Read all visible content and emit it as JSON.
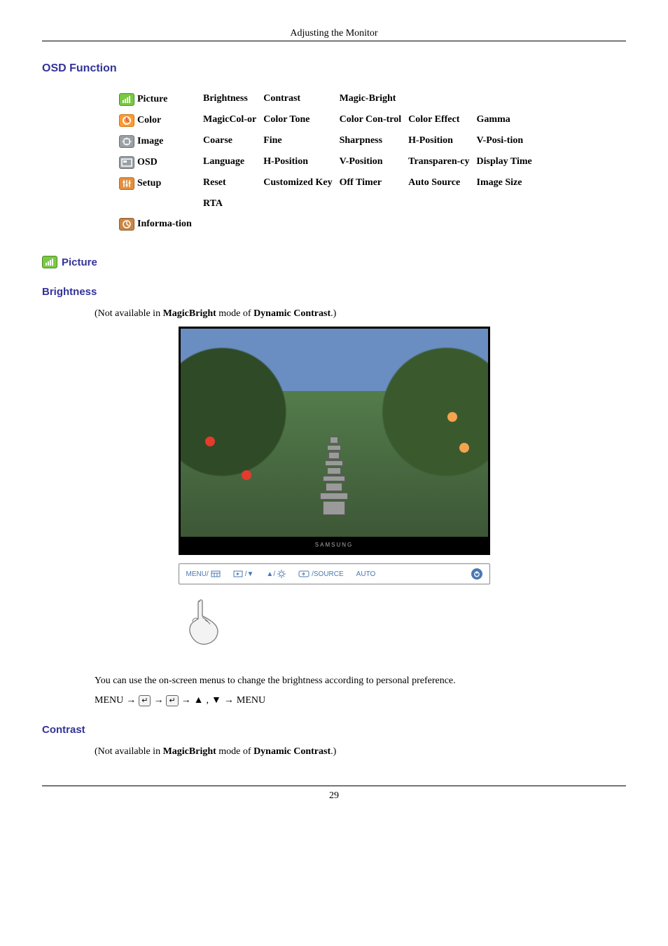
{
  "header_title": "Adjusting the Monitor",
  "sections": {
    "osd_function": "OSD Function",
    "picture": "Picture",
    "brightness": "Brightness",
    "contrast": "Contrast"
  },
  "osd_rows": {
    "picture": {
      "label": "Picture",
      "c1": "Brightness",
      "c2": "Contrast",
      "c3": "Magic-Bright",
      "c4": "",
      "c5": ""
    },
    "color": {
      "label": "Color",
      "c1": "MagicCol-or",
      "c2": "Color Tone",
      "c3": "Color Con-trol",
      "c4": "Color Effect",
      "c5": "Gamma"
    },
    "image": {
      "label": "Image",
      "c1": "Coarse",
      "c2": "Fine",
      "c3": "Sharpness",
      "c4": "H-Position",
      "c5": "V-Posi-tion"
    },
    "osd": {
      "label": "OSD",
      "c1": "Language",
      "c2": "H-Position",
      "c3": "V-Position",
      "c4": "Transparen-cy",
      "c5": "Display Time"
    },
    "setup": {
      "label": "Setup",
      "c1": "Reset",
      "c2": "Customized Key",
      "c3": "Off Timer",
      "c4": "Auto Source",
      "c5": "Image Size"
    },
    "rta": {
      "c1": "RTA"
    },
    "information": {
      "label": "Informa-tion"
    }
  },
  "brightness": {
    "note_prefix": "(Not available in ",
    "note_bold1": "MagicBright",
    "note_mid": "  mode of ",
    "note_bold2": "Dynamic Contrast",
    "note_suffix": ".)",
    "samsung": "SAMSUNG",
    "buttons": {
      "menu": "MENU/",
      "source": "/SOURCE",
      "auto": "AUTO"
    },
    "desc": "You can use the on-screen menus to change the brightness according to personal preference.",
    "nav": {
      "menu": "MENU",
      "arrow": "→",
      "comma": ",",
      "end": "MENU"
    }
  },
  "contrast": {
    "note_prefix": "(Not available in ",
    "note_bold1": "MagicBright",
    "note_mid": " mode of ",
    "note_bold2": "Dynamic Contrast",
    "note_suffix": ".)"
  },
  "page_number": "29"
}
